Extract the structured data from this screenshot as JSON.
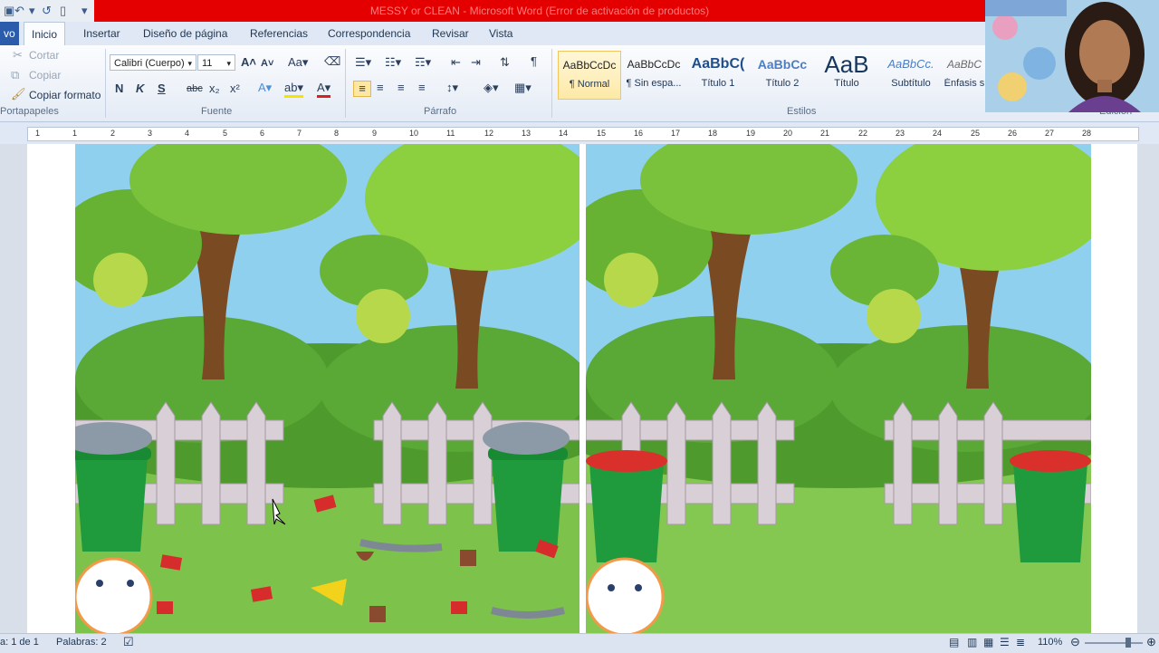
{
  "window": {
    "title": "MESSY  or  CLEAN  -  Microsoft Word (Error de activación de productos)"
  },
  "tabs": [
    {
      "label": "vo"
    },
    {
      "label": "Inicio"
    },
    {
      "label": "Insertar"
    },
    {
      "label": "Diseño de página"
    },
    {
      "label": "Referencias"
    },
    {
      "label": "Correspondencia"
    },
    {
      "label": "Revisar"
    },
    {
      "label": "Vista"
    }
  ],
  "clipboard": {
    "cut": "Cortar",
    "copy": "Copiar",
    "format_painter": "Copiar formato",
    "label": "Portapapeles"
  },
  "font": {
    "name": "Calibri (Cuerpo)",
    "size": "11",
    "label": "Fuente",
    "bold": "N",
    "italic": "K",
    "underline": "S",
    "strike": "abc"
  },
  "paragraph": {
    "label": "Párrafo"
  },
  "styles": {
    "label": "Estilos",
    "items": [
      {
        "preview": "AaBbCcDc",
        "name": "¶ Normal"
      },
      {
        "preview": "AaBbCcDc",
        "name": "¶ Sin espa..."
      },
      {
        "preview": "AaBbC(",
        "name": "Título 1"
      },
      {
        "preview": "AaBbCc",
        "name": "Título 2"
      },
      {
        "preview": "AaB",
        "name": "Título"
      },
      {
        "preview": "AaBbCc.",
        "name": "Subtítulo"
      },
      {
        "preview": "AaBbC",
        "name": "Énfasis s"
      }
    ]
  },
  "editing": {
    "label": "Edición"
  },
  "ruler": {
    "numbers": [
      "1",
      "1",
      "2",
      "3",
      "4",
      "5",
      "6",
      "7",
      "8",
      "9",
      "10",
      "11",
      "12",
      "13",
      "14",
      "15",
      "16",
      "17",
      "18",
      "19",
      "20",
      "21",
      "22",
      "23",
      "24",
      "25",
      "26",
      "27",
      "28"
    ]
  },
  "status": {
    "page": "a: 1 de 1",
    "words": "Palabras: 2",
    "zoom": "110%"
  },
  "colors": {
    "accent": "#2a5cab",
    "title_bar": "#e40000",
    "bin_green": "#1f9a3c",
    "bin_lid_red": "#d9302b"
  }
}
